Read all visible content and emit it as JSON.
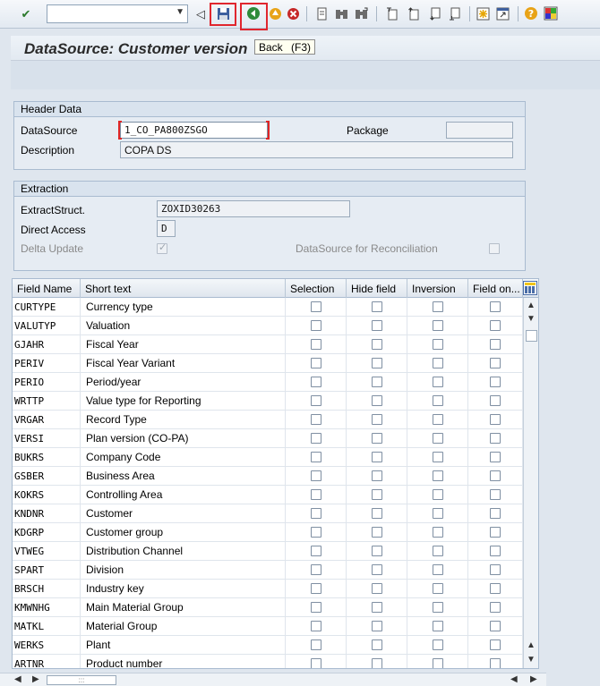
{
  "tooltip": {
    "label": "Back",
    "shortcut": "(F3)"
  },
  "title": "DataSource: Customer version",
  "header_group": {
    "title": "Header Data",
    "datasource_label": "DataSource",
    "datasource_value": "1_CO_PA800ZSGO",
    "package_label": "Package",
    "package_value": "",
    "description_label": "Description",
    "description_value": "COPA DS"
  },
  "extraction_group": {
    "title": "Extraction",
    "extract_label": "ExtractStruct.",
    "extract_value": "ZOXID30263",
    "direct_label": "Direct Access",
    "direct_value": "D",
    "delta_label": "Delta Update",
    "recon_label": "DataSource for Reconciliation"
  },
  "table": {
    "headers": [
      "Field Name",
      "Short text",
      "Selection",
      "Hide field",
      "Inversion",
      "Field on..."
    ],
    "rows": [
      {
        "field": "CURTYPE",
        "text": "Currency type"
      },
      {
        "field": "VALUTYP",
        "text": "Valuation"
      },
      {
        "field": "GJAHR",
        "text": "Fiscal Year"
      },
      {
        "field": "PERIV",
        "text": "Fiscal Year Variant"
      },
      {
        "field": "PERIO",
        "text": "Period/year"
      },
      {
        "field": "WRTTP",
        "text": "Value type for Reporting"
      },
      {
        "field": "VRGAR",
        "text": "Record Type"
      },
      {
        "field": "VERSI",
        "text": "Plan version (CO-PA)"
      },
      {
        "field": "BUKRS",
        "text": "Company Code"
      },
      {
        "field": "GSBER",
        "text": "Business Area"
      },
      {
        "field": "KOKRS",
        "text": "Controlling Area"
      },
      {
        "field": "KNDNR",
        "text": "Customer"
      },
      {
        "field": "KDGRP",
        "text": "Customer group"
      },
      {
        "field": "VTWEG",
        "text": "Distribution Channel"
      },
      {
        "field": "SPART",
        "text": "Division"
      },
      {
        "field": "BRSCH",
        "text": "Industry key"
      },
      {
        "field": "KMWNHG",
        "text": "Main Material Group"
      },
      {
        "field": "MATKL",
        "text": "Material Group"
      },
      {
        "field": "WERKS",
        "text": "Plant"
      },
      {
        "field": "ARTNR",
        "text": "Product number"
      }
    ]
  },
  "icons": [
    "check-icon",
    "save-icon",
    "back-icon",
    "exit-icon",
    "cancel-icon",
    "print-icon",
    "find-icon",
    "find-next-icon",
    "first-page-icon",
    "previous-page-icon",
    "next-page-icon",
    "last-page-icon",
    "new-session-icon",
    "shortcut-icon",
    "help-icon",
    "customize-layout-icon"
  ],
  "colors": {
    "highlight": "#e0262e",
    "accent": "#2b7a2b"
  }
}
